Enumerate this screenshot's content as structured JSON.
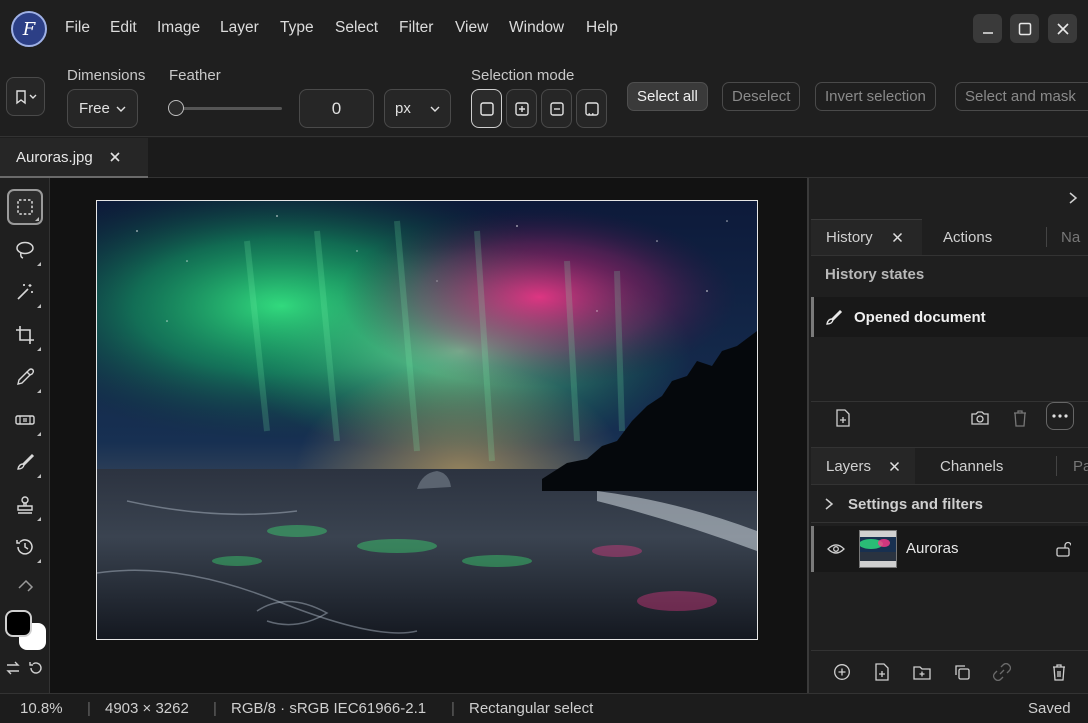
{
  "app": {
    "logo_letter": "F"
  },
  "menu": [
    "File",
    "Edit",
    "Image",
    "Layer",
    "Type",
    "Select",
    "Filter",
    "View",
    "Window",
    "Help"
  ],
  "options": {
    "dimensions_label": "Dimensions",
    "dimensions_value": "Free",
    "feather_label": "Feather",
    "feather_value": "0",
    "feather_unit": "px",
    "feather_slider_level": 0,
    "selection_mode_label": "Selection mode",
    "select_all": "Select all",
    "deselect": "Deselect",
    "invert_selection": "Invert selection",
    "select_and_mask": "Select and mask"
  },
  "document_tab": {
    "name": "Auroras.jpg"
  },
  "history_panel": {
    "tabs": [
      "History",
      "Actions",
      "Na"
    ],
    "section_title": "History states",
    "states": [
      "Opened document"
    ]
  },
  "layers_panel": {
    "tabs": [
      "Layers",
      "Channels",
      "Pa"
    ],
    "settings_label": "Settings and filters",
    "layers": [
      {
        "name": "Auroras"
      }
    ]
  },
  "status": {
    "zoom": "10.8%",
    "dimensions": "4903 × 3262",
    "color_mode": "RGB/8 · sRGB IEC61966-2.1",
    "tool": "Rectangular select",
    "save_state": "Saved"
  },
  "colors": {
    "foreground": "#000000",
    "background": "#ffffff",
    "accent": "#9fb1e6"
  }
}
